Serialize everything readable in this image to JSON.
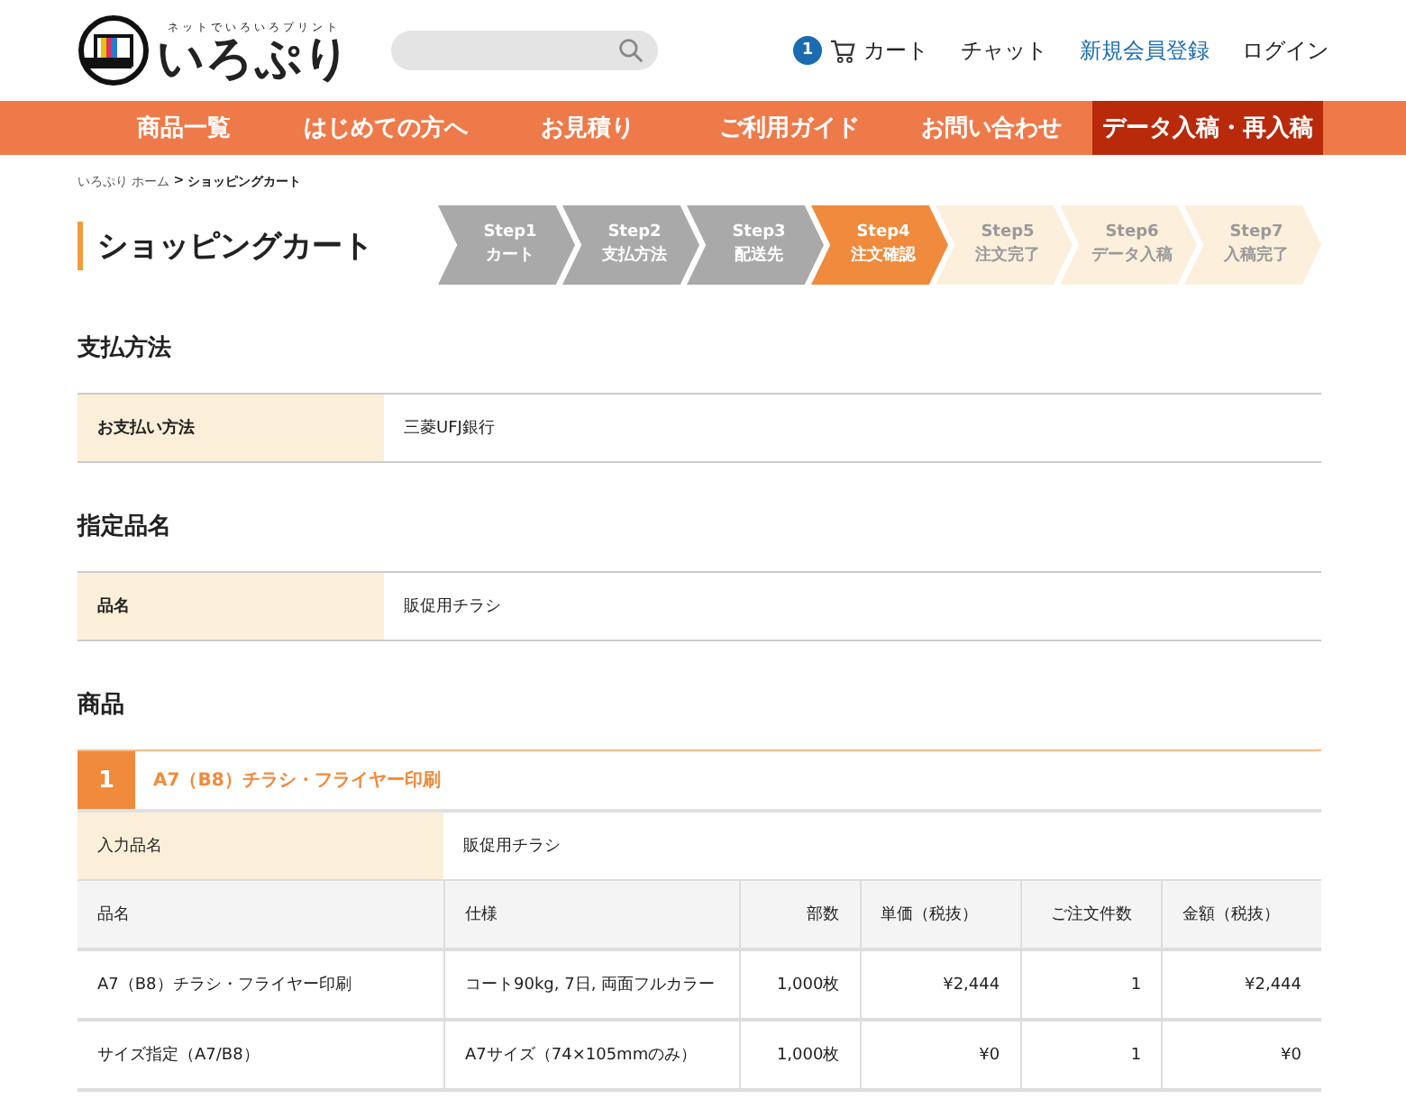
{
  "header": {
    "logo": {
      "tagline": "ネットでいろいろプリント",
      "name": "いろぷり"
    },
    "cart": {
      "count": "1",
      "label": "カート"
    },
    "links": [
      {
        "label": "チャット",
        "kind": "plain"
      },
      {
        "label": "新規会員登録",
        "kind": "accent"
      },
      {
        "label": "ログイン",
        "kind": "plain"
      }
    ]
  },
  "nav": [
    {
      "label": "商品一覧",
      "selected": false
    },
    {
      "label": "はじめての方へ",
      "selected": false
    },
    {
      "label": "お見積り",
      "selected": false
    },
    {
      "label": "ご利用ガイド",
      "selected": false
    },
    {
      "label": "お問い合わせ",
      "selected": false
    },
    {
      "label": "データ入稿・再入稿",
      "selected": true
    }
  ],
  "breadcrumb": [
    {
      "label": "いろぷり ホーム"
    },
    {
      "label": "ショッピングカート"
    }
  ],
  "breadcrumb_separator": ">",
  "page_title": "ショッピングカート",
  "steps": [
    {
      "step": "Step1",
      "label": "カート",
      "completed": true,
      "selected": false
    },
    {
      "step": "Step2",
      "label": "支払方法",
      "completed": true,
      "selected": false
    },
    {
      "step": "Step3",
      "label": "配送先",
      "completed": true,
      "selected": false
    },
    {
      "step": "Step4",
      "label": "注文確認",
      "completed": false,
      "selected": true
    },
    {
      "step": "Step5",
      "label": "注文完了",
      "completed": false,
      "selected": false
    },
    {
      "step": "Step6",
      "label": "データ入稿",
      "completed": false,
      "selected": false
    },
    {
      "step": "Step7",
      "label": "入稿完了",
      "completed": false,
      "selected": false
    }
  ],
  "payment": {
    "heading": "支払方法",
    "label": "お支払い方法",
    "value": "三菱UFJ銀行"
  },
  "product_name": {
    "heading": "指定品名",
    "label": "品名",
    "value": "販促用チラシ"
  },
  "products": {
    "heading": "商品",
    "items": [
      {
        "number": "1",
        "title": "A7（B8）チラシ・フライヤー印刷",
        "input_label": "入力品名",
        "input_value": "販促用チラシ",
        "columns": [
          "品名",
          "仕様",
          "部数",
          "単価（税抜）",
          "ご注文件数",
          "金額（税抜）"
        ],
        "rows": [
          [
            "A7（B8）チラシ・フライヤー印刷",
            "コート90kg, 7日, 両面フルカラー",
            "1,000枚",
            "¥2,444",
            "1",
            "¥2,444"
          ],
          [
            "サイズ指定（A7/B8）",
            "A7サイズ（74×105mmのみ）",
            "1,000枚",
            "¥0",
            "1",
            "¥0"
          ]
        ]
      }
    ]
  }
}
